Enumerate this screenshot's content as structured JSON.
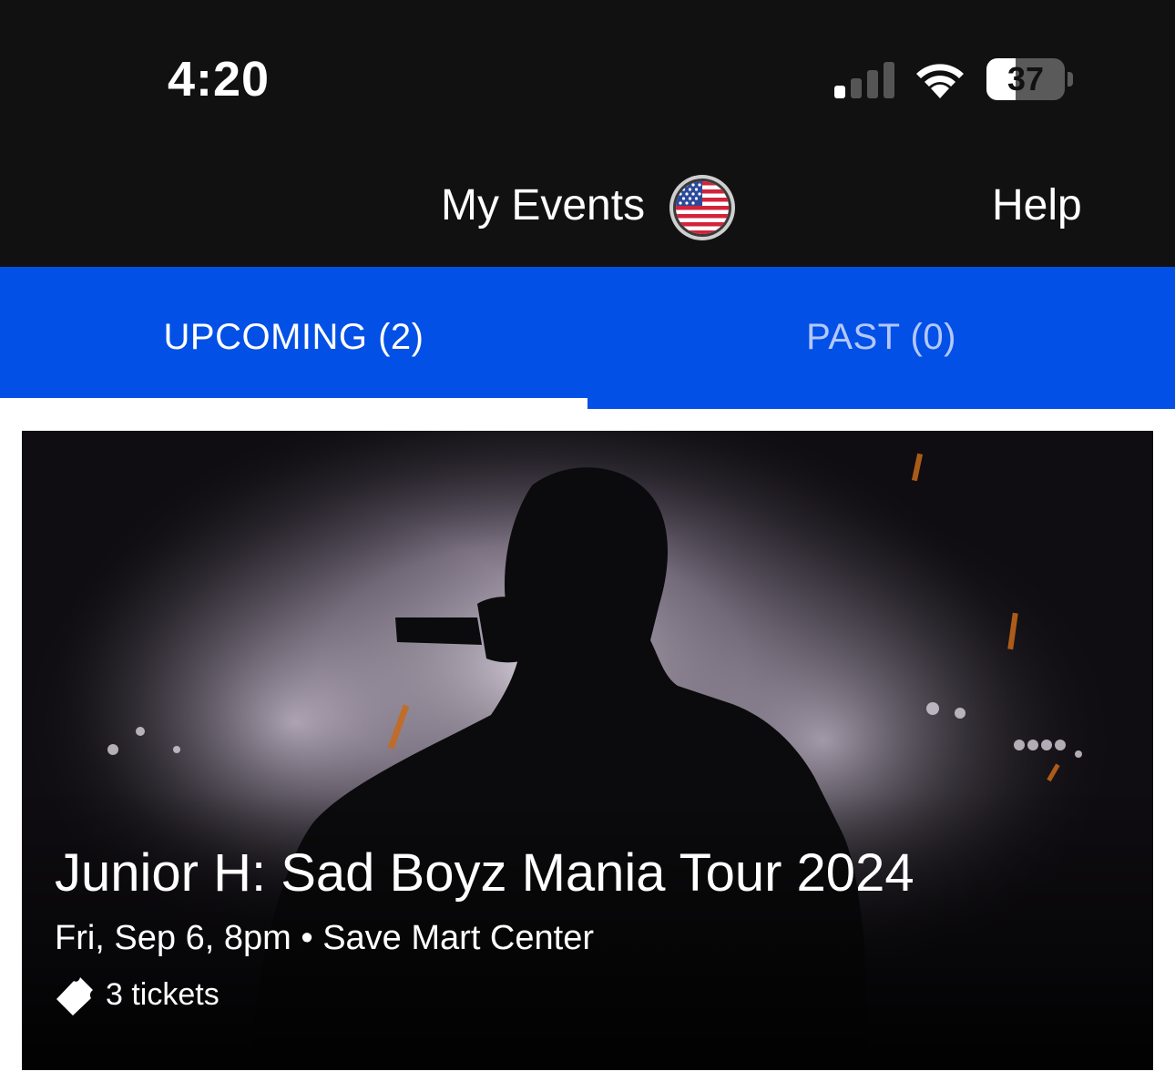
{
  "status_bar": {
    "time": "4:20",
    "battery_level": "37",
    "battery_fraction": 0.37,
    "signal_bars_active": 1,
    "signal_bars_total": 4,
    "icons": [
      "signal-icon",
      "wifi-icon",
      "battery-icon"
    ]
  },
  "header": {
    "title": "My Events",
    "region_icon": "us-flag-icon",
    "help_label": "Help"
  },
  "tabs": [
    {
      "label": "UPCOMING (2)",
      "active": true
    },
    {
      "label": "PAST (0)",
      "active": false
    }
  ],
  "events": [
    {
      "title": "Junior H: Sad Boyz Mania Tour 2024",
      "date": "Fri, Sep 6, 8pm",
      "separator": "•",
      "venue": "Save Mart Center",
      "tickets": "3 tickets",
      "ticket_icon": "ticket-icon"
    }
  ],
  "colors": {
    "header_bg": "#111111",
    "tab_bar_bg": "#0350e6",
    "tab_active_text": "#ffffff",
    "tab_inactive_text": "#b3c8ff",
    "tab_indicator": "#ffffff"
  }
}
